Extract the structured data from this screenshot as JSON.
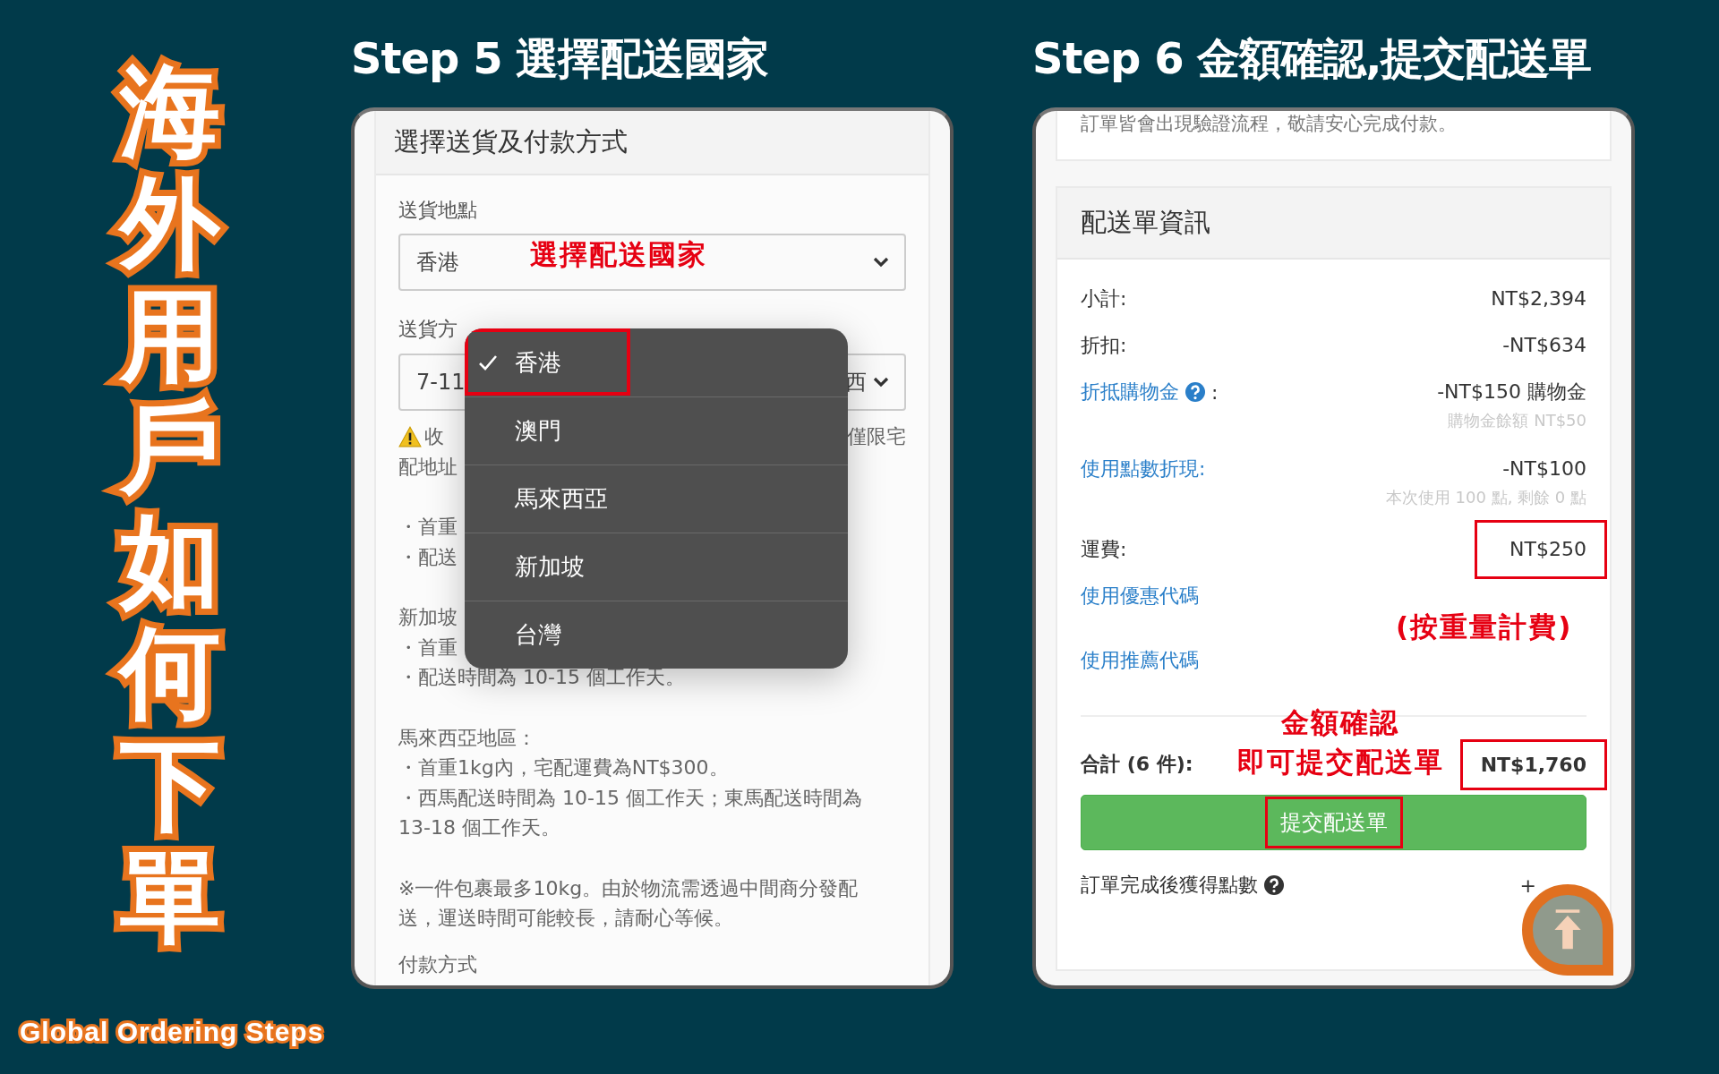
{
  "page_title": "海外用戶如何下單",
  "subtitle": "Global Ordering Steps",
  "step5": {
    "heading": "Step 5 選擇配送國家",
    "card_title": "選擇送貨及付款方式",
    "location": {
      "label": "送貨地點",
      "value": "香港"
    },
    "method": {
      "label": "送貨方",
      "value": "7-11",
      "value_end": "西"
    },
    "notes": [
      [
        {
          "kind": "warning",
          "text": "收",
          "text_right": "僅限宅"
        },
        {
          "kind": "text",
          "text": "配地址"
        }
      ],
      [
        {
          "kind": "text",
          "text": "・首重"
        },
        {
          "kind": "text",
          "text": "・配送"
        }
      ],
      [
        {
          "kind": "text",
          "text": "新加坡"
        },
        {
          "kind": "text",
          "text": "・首重"
        },
        {
          "kind": "text",
          "text": "・配送時間為 10-15 個工作天。"
        }
      ],
      [
        {
          "kind": "text",
          "text": "馬來西亞地區："
        },
        {
          "kind": "text",
          "text": "・首重1kg內，宅配運費為NT$300。"
        },
        {
          "kind": "text",
          "text": "・西馬配送時間為 10-15 個工作天；東馬配送時間為"
        },
        {
          "kind": "text",
          "text": "13-18 個工作天。"
        }
      ],
      [
        {
          "kind": "text",
          "text": "※一件包裹最多10kg。由於物流需透過中間商分發配"
        },
        {
          "kind": "text",
          "text": "送，運送時間可能較長，請耐心等候。"
        }
      ],
      [
        {
          "kind": "text",
          "text": "付款方式"
        }
      ]
    ],
    "annotation": "選擇配送國家",
    "menu": [
      {
        "label": "香港",
        "selected": true,
        "highlighted": true
      },
      {
        "label": "澳門",
        "selected": false,
        "highlighted": false
      },
      {
        "label": "馬來西亞",
        "selected": false,
        "highlighted": false
      },
      {
        "label": "新加坡",
        "selected": false,
        "highlighted": false
      },
      {
        "label": "台灣",
        "selected": false,
        "highlighted": false
      }
    ]
  },
  "step6": {
    "heading": "Step 6 金額確認,提交配送單",
    "notice": "訂單皆會出現驗證流程，敬請安心完成付款。",
    "summary_title": "配送單資訊",
    "rows": [
      {
        "kind": "plain",
        "label": "小計:",
        "value": "NT$2,394",
        "highlighted": false
      },
      {
        "kind": "plain",
        "label": "折扣:",
        "value": "-NT$634",
        "highlighted": false
      },
      {
        "kind": "link",
        "label": "折抵購物金",
        "help": true,
        "label_suffix": ":",
        "value": "-NT$150 購物金",
        "note": "購物金餘額 NT$50",
        "highlighted": false
      },
      {
        "kind": "link",
        "label": "使用點數折現:",
        "help": false,
        "value": "-NT$100",
        "note": "本次使用 100 點, 剩餘 0 點",
        "highlighted": false
      },
      {
        "kind": "plain",
        "label": "運費:",
        "value": "NT$250",
        "highlighted": true
      }
    ],
    "links": [
      "使用優惠代碼",
      "使用推薦代碼"
    ],
    "weight_note": "(按重量計費)",
    "confirm_note": [
      "金額確認",
      "即可提交配送單"
    ],
    "total": {
      "label": "合計 (6 件):",
      "value": "NT$1,760",
      "highlighted": true
    },
    "submit": {
      "label": "提交配送單",
      "highlighted": true
    },
    "points": {
      "label": "訂單完成後獲得點數",
      "value": "+"
    }
  }
}
